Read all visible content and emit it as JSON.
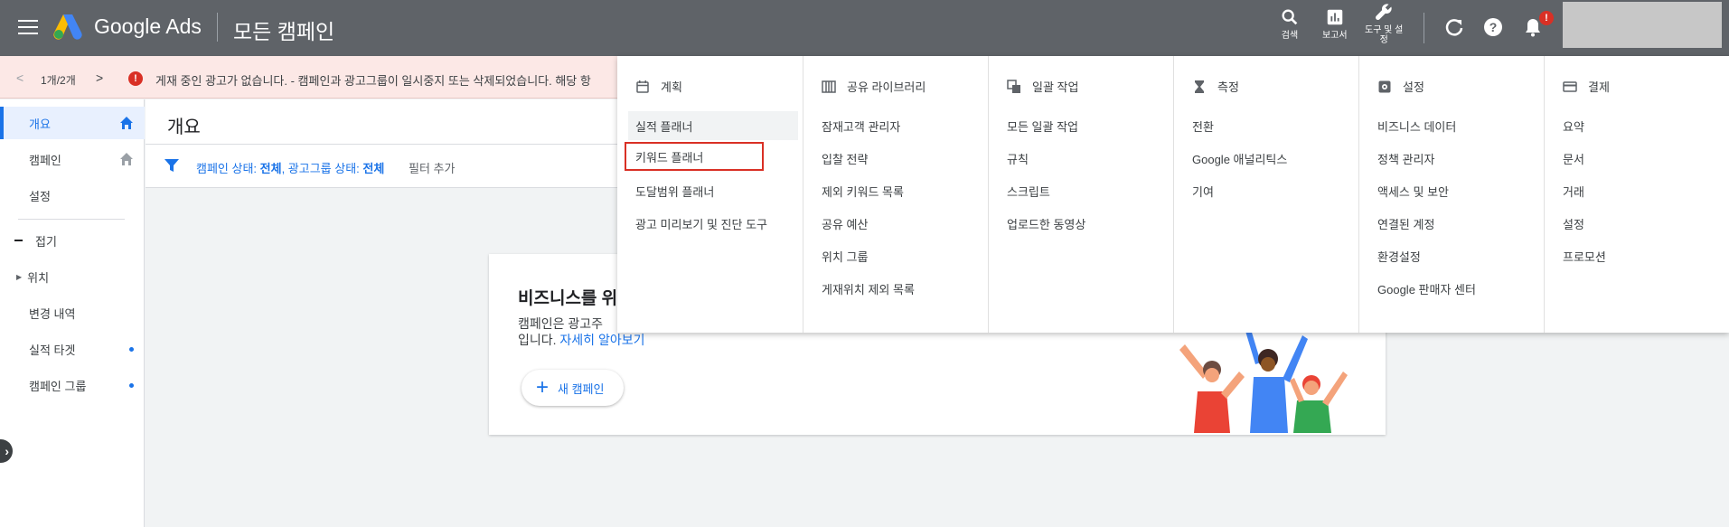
{
  "header": {
    "brand": "Google Ads",
    "page_title": "모든 캠페인",
    "search_label": "검색",
    "reports_label": "보고서",
    "tools_label_line1": "도구 및 설",
    "tools_label_line2": "정",
    "notification_badge": "!"
  },
  "alert": {
    "prev": "<",
    "count": "1개/2개",
    "next": ">",
    "icon": "!",
    "text": "게재 중인 광고가 없습니다. - 캠페인과 광고그룹이 일시중지 또는 삭제되었습니다. 해당 항"
  },
  "sidebar": {
    "items": [
      {
        "label": "개요"
      },
      {
        "label": "캠페인"
      },
      {
        "label": "설정"
      },
      {
        "label": "접기"
      },
      {
        "label": "위치"
      },
      {
        "label": "변경 내역"
      },
      {
        "label": "실적 타겟"
      },
      {
        "label": "캠페인 그룹"
      }
    ]
  },
  "main": {
    "title": "개요",
    "filter_prefix1": "캠페인 상태: ",
    "filter_value1": "전체",
    "filter_prefix2": ", 광고그룹 상태: ",
    "filter_value2": "전체",
    "add_filter": "필터 추가"
  },
  "card": {
    "title": "비즈니스를 위",
    "desc_line1": "캠페인은 광고주",
    "desc_line2": "입니다. ",
    "learn_more": "자세히 알아보기",
    "new_campaign": "새 캠페인"
  },
  "menu": {
    "columns": [
      {
        "heading": "계획",
        "icon": "calendar-icon",
        "items": [
          "실적 플래너",
          "키워드 플래너",
          "도달범위 플래너",
          "광고 미리보기 및 진단 도구"
        ]
      },
      {
        "heading": "공유 라이브러리",
        "icon": "library-icon",
        "items": [
          "잠재고객 관리자",
          "입찰 전략",
          "제외 키워드 목록",
          "공유 예산",
          "위치 그룹",
          "게재위치 제외 목록"
        ]
      },
      {
        "heading": "일괄 작업",
        "icon": "copy-icon",
        "items": [
          "모든 일괄 작업",
          "규칙",
          "스크립트",
          "업로드한 동영상"
        ]
      },
      {
        "heading": "측정",
        "icon": "hourglass-icon",
        "items": [
          "전환",
          "Google 애널리틱스",
          "기여"
        ]
      },
      {
        "heading": "설정",
        "icon": "gear-icon",
        "items": [
          "비즈니스 데이터",
          "정책 관리자",
          "액세스 및 보안",
          "연결된 계정",
          "환경설정",
          "Google 판매자 센터"
        ]
      },
      {
        "heading": "결제",
        "icon": "card-icon",
        "items": [
          "요약",
          "문서",
          "거래",
          "설정",
          "프로모션"
        ]
      }
    ]
  },
  "colors": {
    "header_bg": "#5f6368",
    "accent": "#1a73e8",
    "alert_bg": "#fce8e6",
    "error": "#d93025"
  }
}
